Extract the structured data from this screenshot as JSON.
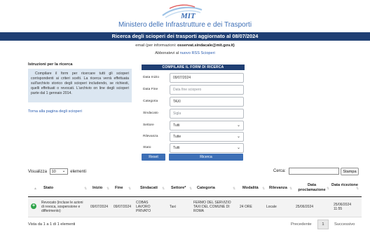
{
  "header": {
    "logo_text": "MIT",
    "ministry": "Ministero delle Infrastrutture e dei Trasporti",
    "title": "Ricerca degli scioperi dei trasporti aggiornato al 08/07/2024",
    "email_label": "email (per informazioni:",
    "email_value": "osservat.sindacale@mit.gov.it)",
    "rss_prefix": "Abbonatevi al",
    "rss_link": "nuovo RSS Scioperi"
  },
  "instructions": {
    "title": "Istruzioni per la ricerca",
    "text": "Compilare il form per ricercare tutti gli scioperi corrispondenti ai criteri scelti. La ricerca verrà effettuata sull'archivio storico degli scioperi includendo, se richiesti, quelli effettuati o revocati. L'archivio on line degli scioperi parte dal 1 gennaio 2014.",
    "back_link": "Torna alla pagina degli scioperi"
  },
  "form": {
    "heading": "Compilare il form di ricerca",
    "fields": [
      {
        "label": "Data Inizio",
        "value": "09/07/2024",
        "placeholder": "",
        "type": "text"
      },
      {
        "label": "Data Fine",
        "value": "",
        "placeholder": "Data fine sciopero",
        "type": "text"
      },
      {
        "label": "Categoria",
        "value": "TAXI",
        "placeholder": "",
        "type": "text"
      },
      {
        "label": "Sindacato",
        "value": "",
        "placeholder": "Sigla",
        "type": "text"
      },
      {
        "label": "Settore",
        "value": "Tutti",
        "placeholder": "",
        "type": "select"
      },
      {
        "label": "Rilevanza",
        "value": "Tutte",
        "placeholder": "",
        "type": "select"
      },
      {
        "label": "Stato",
        "value": "Tutti",
        "placeholder": "",
        "type": "select"
      }
    ],
    "reset_label": "Reset",
    "search_label": "Ricerca"
  },
  "table_controls": {
    "show_prefix": "Visualizza",
    "show_value": "10",
    "show_suffix": "elementi",
    "search_label": "Cerca:",
    "print_label": "Stampa"
  },
  "table": {
    "columns": [
      "Stato",
      "Inizio",
      "Fine",
      "Sindacati",
      "Settore*",
      "Categoria",
      "Modalità",
      "Rilevanza",
      "Data proclamazione",
      "Data ricezione"
    ],
    "rows": [
      {
        "stato": "Revocato (incluse le azioni di revoca, sospensione e differimento)",
        "inizio": "09/07/2024",
        "fine": "09/07/2024",
        "sindacati": "COBAS LAVORO PRIVATO",
        "settore": "Taxi",
        "categoria": "FERMO DEL SERVIZIO TAXI DEL COMUNE DI ROMA",
        "modalita": "24 ORE",
        "rilevanza": "Locale",
        "proclamazione": "25/06/2024",
        "ricezione": "25/06/2024 11:55"
      }
    ],
    "info": "Vista da 1 a 1 di 1 elementi",
    "prev": "Precedente",
    "page": "1",
    "next": "Successivo"
  }
}
